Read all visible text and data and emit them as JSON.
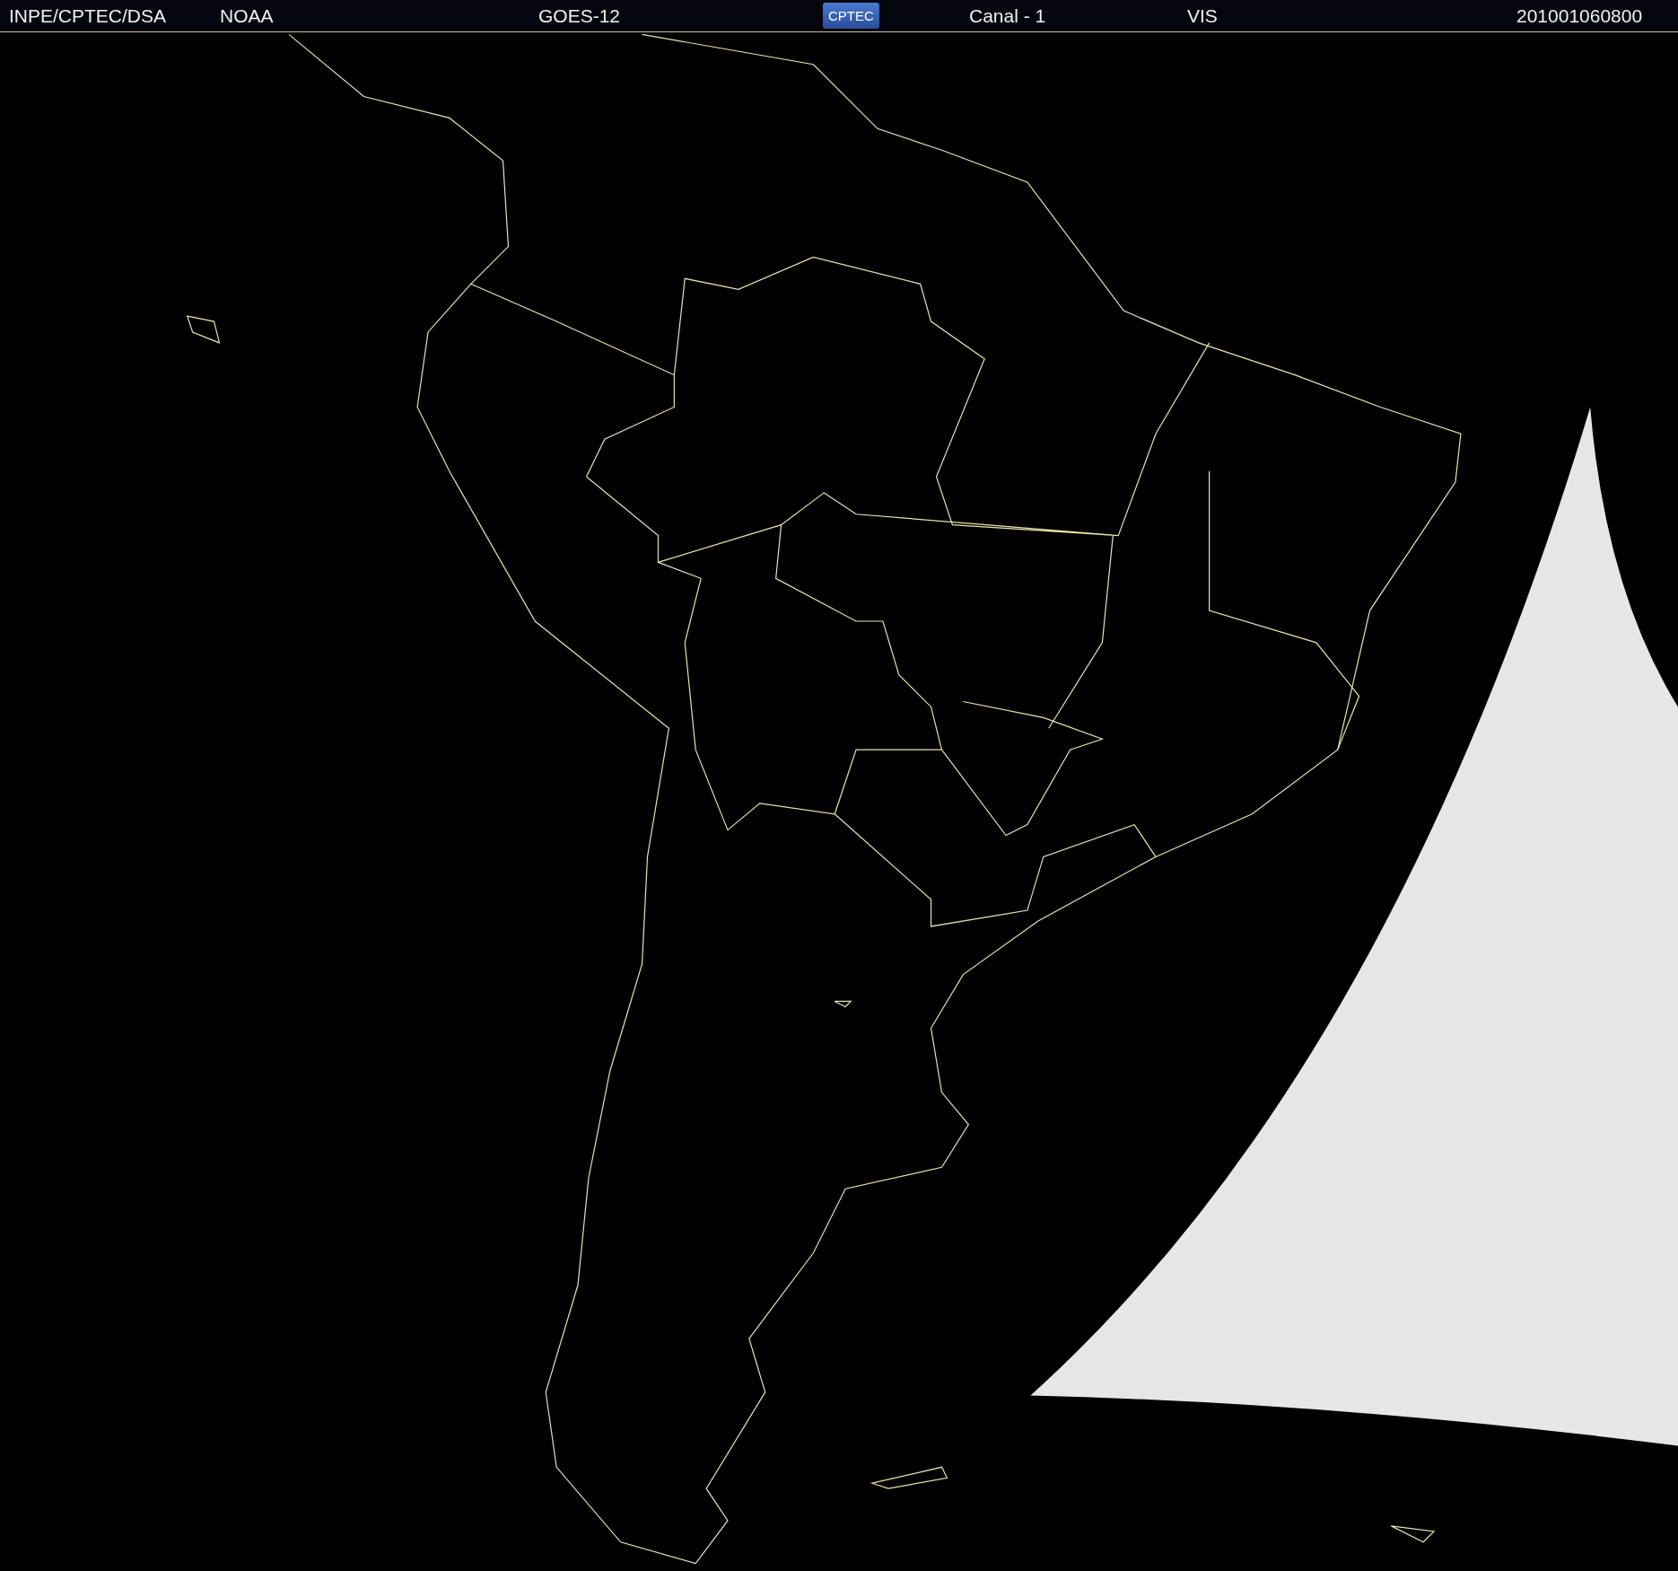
{
  "header": {
    "items": [
      {
        "kind": "text",
        "text": "INPE/CPTEC/DSA"
      },
      {
        "kind": "text",
        "text": "NOAA"
      },
      {
        "kind": "text",
        "text": "GOES-12"
      },
      {
        "kind": "logo",
        "text": "CPTEC"
      },
      {
        "kind": "text",
        "text": "Canal - 1"
      },
      {
        "kind": "text",
        "text": "VIS"
      },
      {
        "kind": "text",
        "text": "201001060800"
      }
    ]
  }
}
